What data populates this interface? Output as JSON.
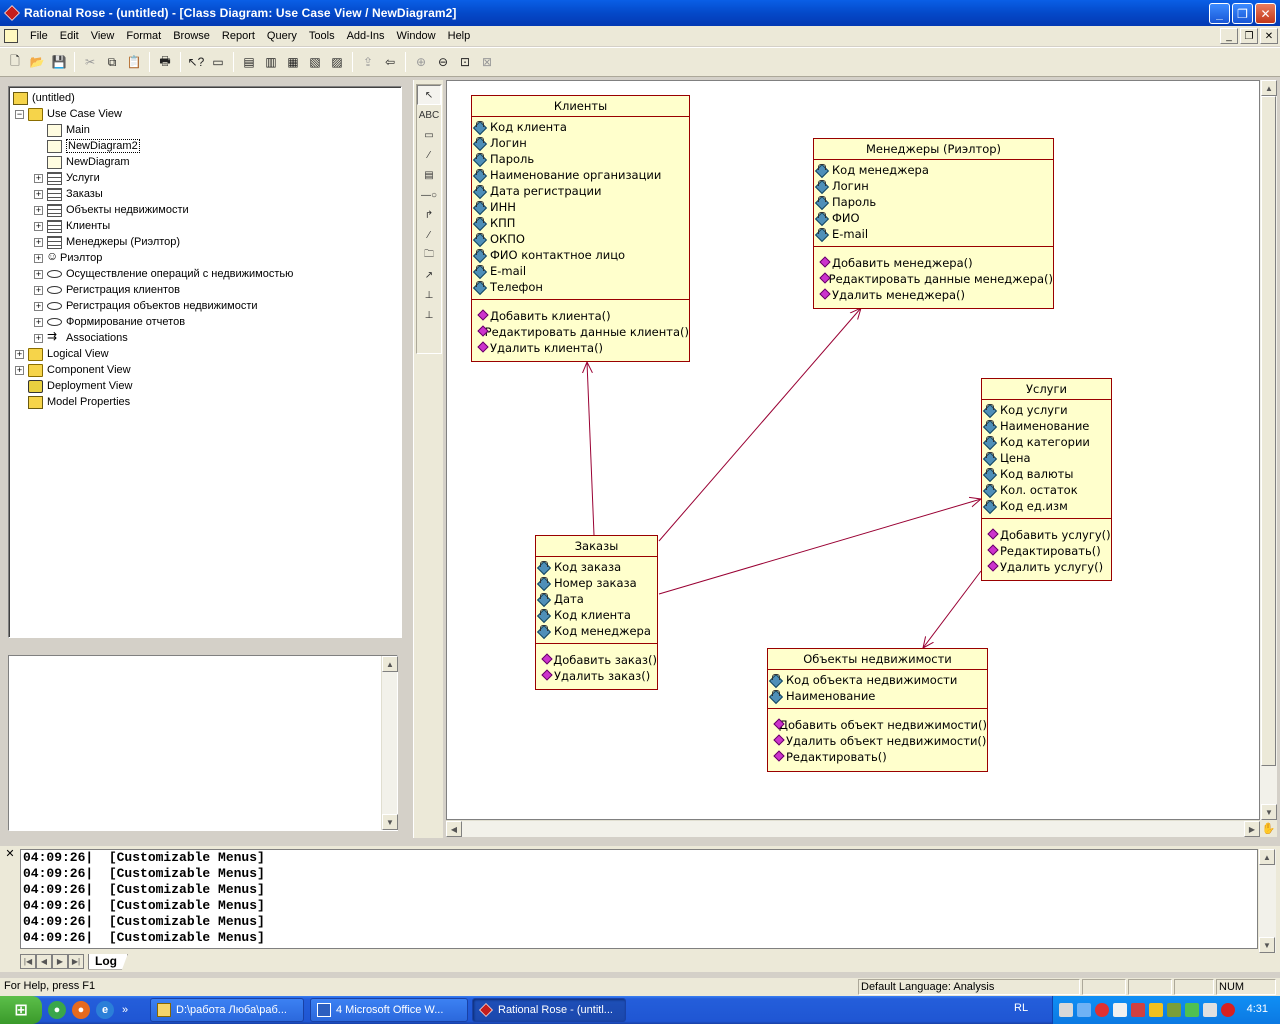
{
  "window": {
    "title": "Rational Rose - (untitled) - [Class Diagram: Use Case View / NewDiagram2]"
  },
  "menu": [
    "File",
    "Edit",
    "View",
    "Format",
    "Browse",
    "Report",
    "Query",
    "Tools",
    "Add-Ins",
    "Window",
    "Help"
  ],
  "tree": {
    "root": "(untitled)",
    "items": [
      {
        "label": "Use Case View",
        "level": 1,
        "icon": "folder",
        "expand": "−"
      },
      {
        "label": "Main",
        "level": 2,
        "icon": "diagram",
        "expand": ""
      },
      {
        "label": "NewDiagram2",
        "level": 2,
        "icon": "diagram",
        "expand": "",
        "selected": true
      },
      {
        "label": "NewDiagram",
        "level": 2,
        "icon": "diagram",
        "expand": ""
      },
      {
        "label": "Услуги",
        "level": 2,
        "icon": "class",
        "expand": "+"
      },
      {
        "label": "Заказы",
        "level": 2,
        "icon": "class",
        "expand": "+"
      },
      {
        "label": "Объекты недвижимости",
        "level": 2,
        "icon": "class",
        "expand": "+"
      },
      {
        "label": "Клиенты",
        "level": 2,
        "icon": "class",
        "expand": "+"
      },
      {
        "label": "Менеджеры (Риэлтор)",
        "level": 2,
        "icon": "class",
        "expand": "+"
      },
      {
        "label": "Риэлтор",
        "level": 2,
        "icon": "actor",
        "expand": "+"
      },
      {
        "label": "Осуществление операций с недвижимостью",
        "level": 2,
        "icon": "usecase",
        "expand": "+"
      },
      {
        "label": "Регистрация клиентов",
        "level": 2,
        "icon": "usecase",
        "expand": "+"
      },
      {
        "label": "Регистрация объектов недвижимости",
        "level": 2,
        "icon": "usecase",
        "expand": "+"
      },
      {
        "label": "Формирование отчетов",
        "level": 2,
        "icon": "usecase",
        "expand": "+"
      },
      {
        "label": "Associations",
        "level": 2,
        "icon": "assoc",
        "expand": "+"
      },
      {
        "label": "Logical View",
        "level": 1,
        "icon": "folder",
        "expand": "+"
      },
      {
        "label": "Component View",
        "level": 1,
        "icon": "folder",
        "expand": "+"
      },
      {
        "label": "Deployment View",
        "level": 1,
        "icon": "deploy",
        "expand": ""
      },
      {
        "label": "Model Properties",
        "level": 1,
        "icon": "model",
        "expand": ""
      }
    ]
  },
  "classes": {
    "clients": {
      "name": "Клиенты",
      "attributes": [
        "Код клиента",
        "Логин",
        "Пароль",
        "Наименование организации",
        "Дата регистрации",
        "ИНН",
        "КПП",
        "ОКПО",
        "ФИО контактное лицо",
        "E-mail",
        "Телефон"
      ],
      "operations": [
        "Добавить клиента()",
        "Редактировать данные клиента()",
        "Удалить клиента()"
      ]
    },
    "managers": {
      "name": "Менеджеры (Риэлтор)",
      "attributes": [
        "Код менеджера",
        "Логин",
        "Пароль",
        "ФИО",
        "E-mail"
      ],
      "operations": [
        "Добавить менеджера()",
        "Редактировать данные менеджера()",
        "Удалить менеджера()"
      ]
    },
    "services": {
      "name": "Услуги",
      "attributes": [
        "Код услуги",
        "Наименование",
        "Код категории",
        "Цена",
        "Код валюты",
        "Кол. остаток",
        "Код ед.изм"
      ],
      "operations": [
        "Добавить услугу()",
        "Редактировать()",
        "Удалить услугу()"
      ]
    },
    "orders": {
      "name": "Заказы",
      "attributes": [
        "Код заказа",
        "Номер заказа",
        "Дата",
        "Код клиента",
        "Код менеджера"
      ],
      "operations": [
        "Добавить заказ()",
        "Удалить заказ()"
      ]
    },
    "realty": {
      "name": "Объекты недвижимости",
      "attributes": [
        "Код объекта недвижимости",
        "Наименование"
      ],
      "operations": [
        "Добавить объект недвижимости()",
        "Удалить объект недвижимости()",
        "Редактировать()"
      ]
    }
  },
  "log": {
    "lines": [
      "04:09:26|  [Customizable Menus]",
      "04:09:26|  [Customizable Menus]",
      "04:09:26|  [Customizable Menus]",
      "04:09:26|  [Customizable Menus]",
      "04:09:26|  [Customizable Menus]",
      "04:09:26|  [Customizable Menus]"
    ],
    "tab": "Log"
  },
  "status": {
    "help": "For Help, press F1",
    "language": "Default Language: Analysis",
    "num": "NUM"
  },
  "taskbar": {
    "tasks": [
      "D:\\работа Люба\\раб...",
      "4 Microsoft Office W...",
      "Rational Rose - (untitl..."
    ],
    "lang": "RL",
    "clock": "4:31"
  },
  "colors": {
    "class_fill": "#ffffcc",
    "class_border": "#990000",
    "assoc_line": "#990033"
  }
}
